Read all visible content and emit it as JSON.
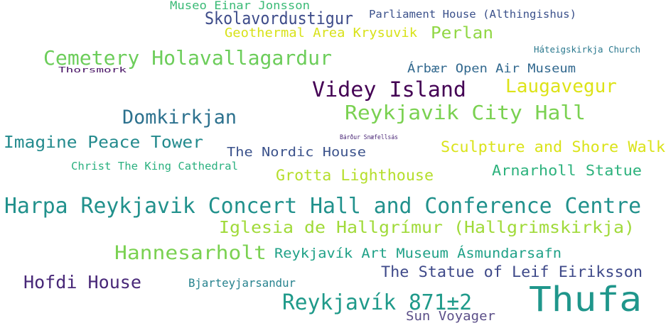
{
  "words": [
    {
      "text": "Museo Einar Jonsson",
      "color": "#3aba76"
    },
    {
      "text": "Skolavordustigur",
      "color": "#3e4c8a"
    },
    {
      "text": "Parliament House (Althingishus)",
      "color": "#3b518b"
    },
    {
      "text": "Geothermal Area Krysuvik",
      "color": "#d8e219"
    },
    {
      "text": "Perlan",
      "color": "#90d743"
    },
    {
      "text": "Cemetery Holavallagardur",
      "color": "#6ccd5a"
    },
    {
      "text": "Háteigskirkja Church",
      "color": "#2a788e"
    },
    {
      "text": "Thorsmork",
      "color": "#471164"
    },
    {
      "text": "Árbær Open Air Museum",
      "color": "#31688e"
    },
    {
      "text": "Videy Island",
      "color": "#440154"
    },
    {
      "text": "Laugavegur",
      "color": "#dde318"
    },
    {
      "text": "Reykjavik City Hall",
      "color": "#7ad151"
    },
    {
      "text": "Domkirkjan",
      "color": "#2c718e"
    },
    {
      "text": "Imagine Peace Tower",
      "color": "#238a8d"
    },
    {
      "text": "Bárður Snæfellsás",
      "color": "#482475"
    },
    {
      "text": "The Nordic House",
      "color": "#3b528b"
    },
    {
      "text": "Sculpture and Shore Walk",
      "color": "#dae319"
    },
    {
      "text": "Christ The King Cathedral",
      "color": "#2ab07f"
    },
    {
      "text": "Grotta Lighthouse",
      "color": "#b5de2b"
    },
    {
      "text": "Arnarholl Statue",
      "color": "#2db27d"
    },
    {
      "text": "Harpa Reykjavik Concert Hall and Conference Centre",
      "color": "#21918c"
    },
    {
      "text": "Iglesia de Hallgrímur (Hallgrimskirkja)",
      "color": "#a0da39"
    },
    {
      "text": "Hannesarholt",
      "color": "#7ad151"
    },
    {
      "text": "Reykjavík Art Museum Ásmundarsafn",
      "color": "#1fa187"
    },
    {
      "text": "The Statue of Leif Eiriksson",
      "color": "#3e4989"
    },
    {
      "text": "Hofdi House",
      "color": "#482878"
    },
    {
      "text": "Bjarteyjarsandur",
      "color": "#26828e"
    },
    {
      "text": "Reykjavík 871±2",
      "color": "#1f9a8a"
    },
    {
      "text": "Sun Voyager",
      "color": "#5b4f88"
    },
    {
      "text": "Thufa",
      "color": "#1f968b"
    }
  ]
}
